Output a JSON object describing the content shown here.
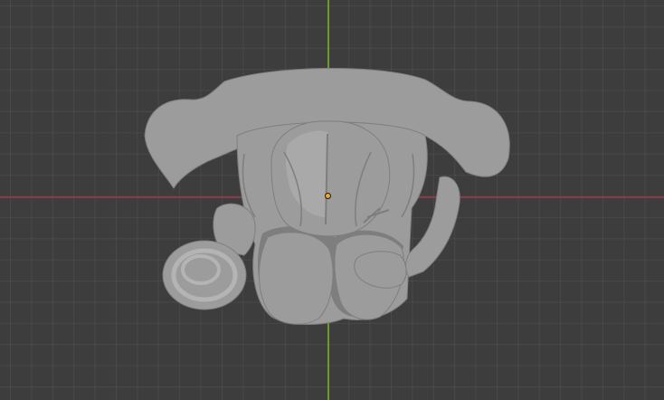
{
  "viewport": {
    "background": "#3d3d3d",
    "grid_color": "#484848",
    "x_axis_color": "#8a3b47",
    "y_axis_color": "#6e9a2c",
    "origin_color": "#f5a623",
    "model_color": "#9c9c9c",
    "model_shade": "#7e7e7e",
    "model_highlight": "#b4b4b4",
    "object_icon": "sculpt-mesh-object"
  }
}
